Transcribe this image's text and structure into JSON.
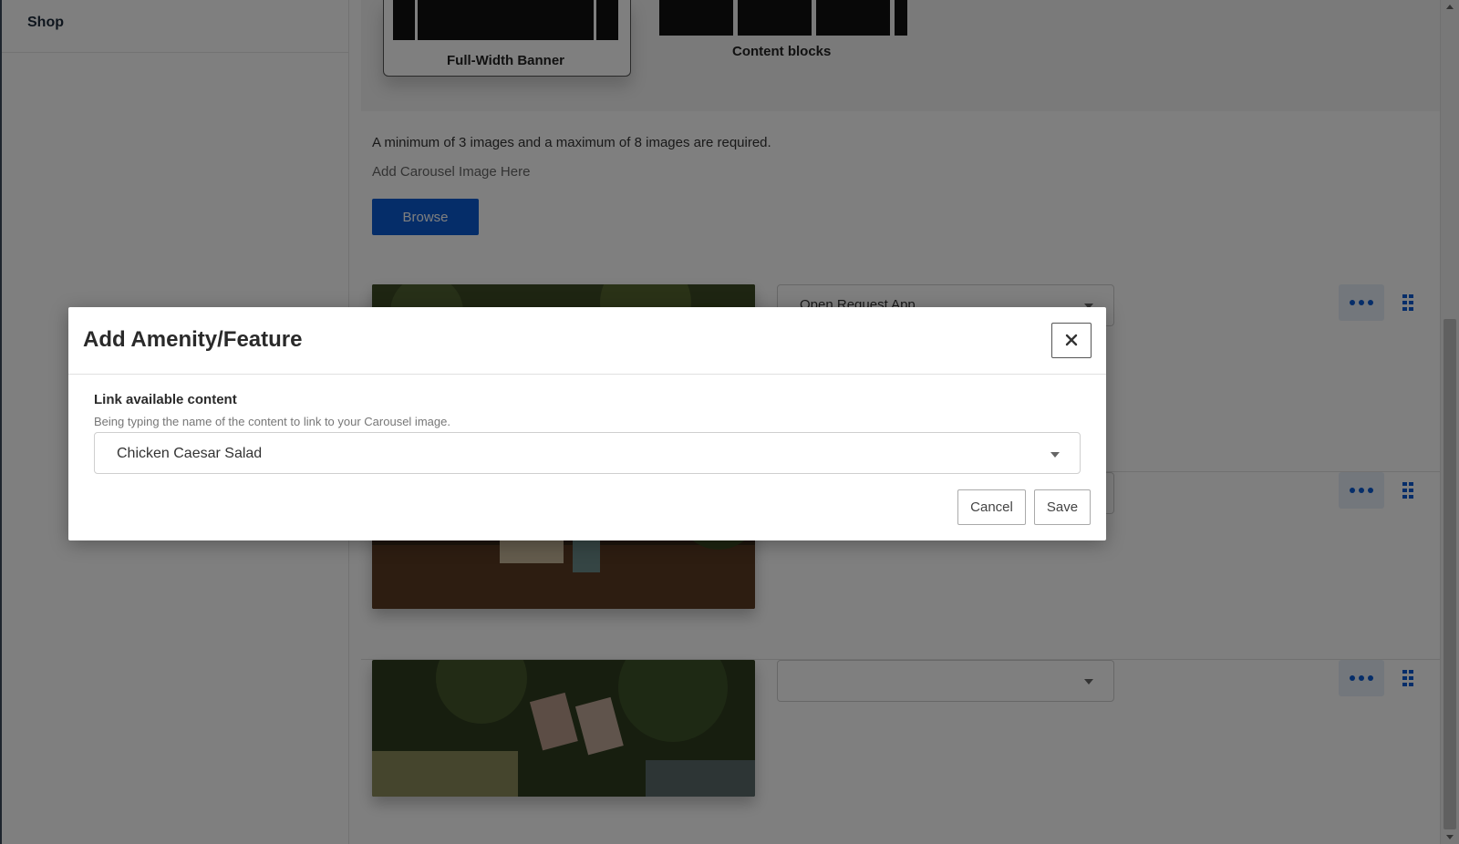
{
  "sidebar": {
    "items": [
      {
        "label": "Shop"
      }
    ]
  },
  "layouts": {
    "banner_label": "Full-Width Banner",
    "blocks_label": "Content blocks"
  },
  "carousel": {
    "requirement_text": "A minimum of 3 images and a maximum of 8 images are required.",
    "upload_label": "Add Carousel Image Here",
    "browse_label": "Browse",
    "rows": [
      {
        "link_value": "Open Request App"
      },
      {
        "link_value": ""
      },
      {
        "link_value": ""
      }
    ]
  },
  "modal": {
    "title": "Add Amenity/Feature",
    "field_label": "Link available content",
    "field_help": "Being typing the name of the content to link to your Carousel image.",
    "selected_value": "Chicken Caesar Salad",
    "cancel_label": "Cancel",
    "save_label": "Save"
  },
  "colors": {
    "accent": "#0b5bd3",
    "overlay": "rgba(0,0,0,0.5)"
  }
}
